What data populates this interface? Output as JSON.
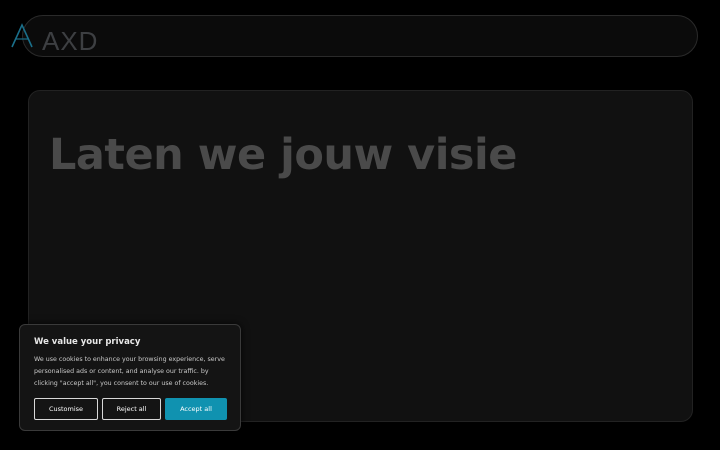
{
  "header": {
    "logo_text": "AXD"
  },
  "hero": {
    "title": "Laten we jouw visie"
  },
  "cookie_banner": {
    "title": "We value your privacy",
    "description": "We use cookies to enhance your browsing experience, serve personalised ads or content, and analyse our traffic. by clicking \"accept all\", you consent to our use of cookies.",
    "customise_label": "Customise",
    "reject_label": "Reject all",
    "accept_label": "Accept all"
  },
  "colors": {
    "background": "#000000",
    "card": "#111111",
    "accent": "#1092b0",
    "logo_accent": "#1a6f8a"
  }
}
